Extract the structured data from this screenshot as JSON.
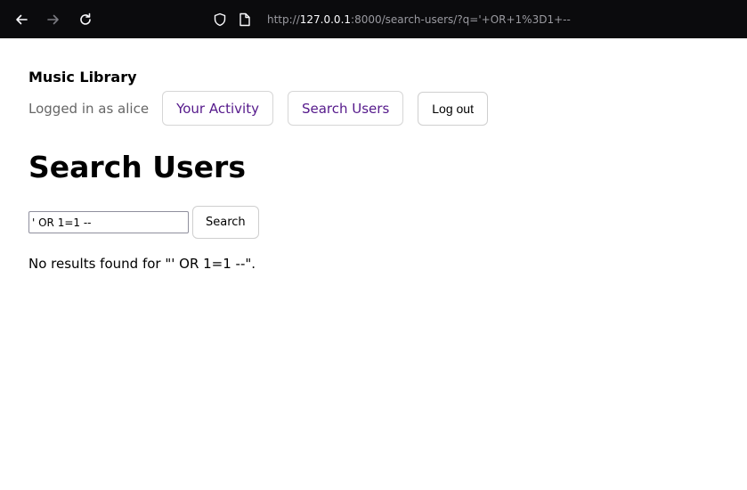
{
  "browser": {
    "url_prefix": "http://",
    "url_host": "127.0.0.1",
    "url_rest": ":8000/search-users/?q='+OR+1%3D1+--"
  },
  "header": {
    "site_title": "Music Library",
    "logged_in_text": "Logged in as alice",
    "nav": [
      {
        "label": "Your Activity"
      },
      {
        "label": "Search Users"
      }
    ],
    "logout_label": "Log out"
  },
  "main": {
    "title": "Search Users",
    "search": {
      "value": "' OR 1=1 --",
      "button_label": "Search"
    },
    "result_message": "No results found for \"' OR 1=1 --\"."
  },
  "colors": {
    "browser_bar": "#0b0b0d",
    "link": "#55198b"
  },
  "icons": {
    "back": "back-arrow-icon",
    "forward": "forward-arrow-icon",
    "reload": "reload-icon",
    "shield": "shield-icon",
    "page": "page-icon"
  }
}
